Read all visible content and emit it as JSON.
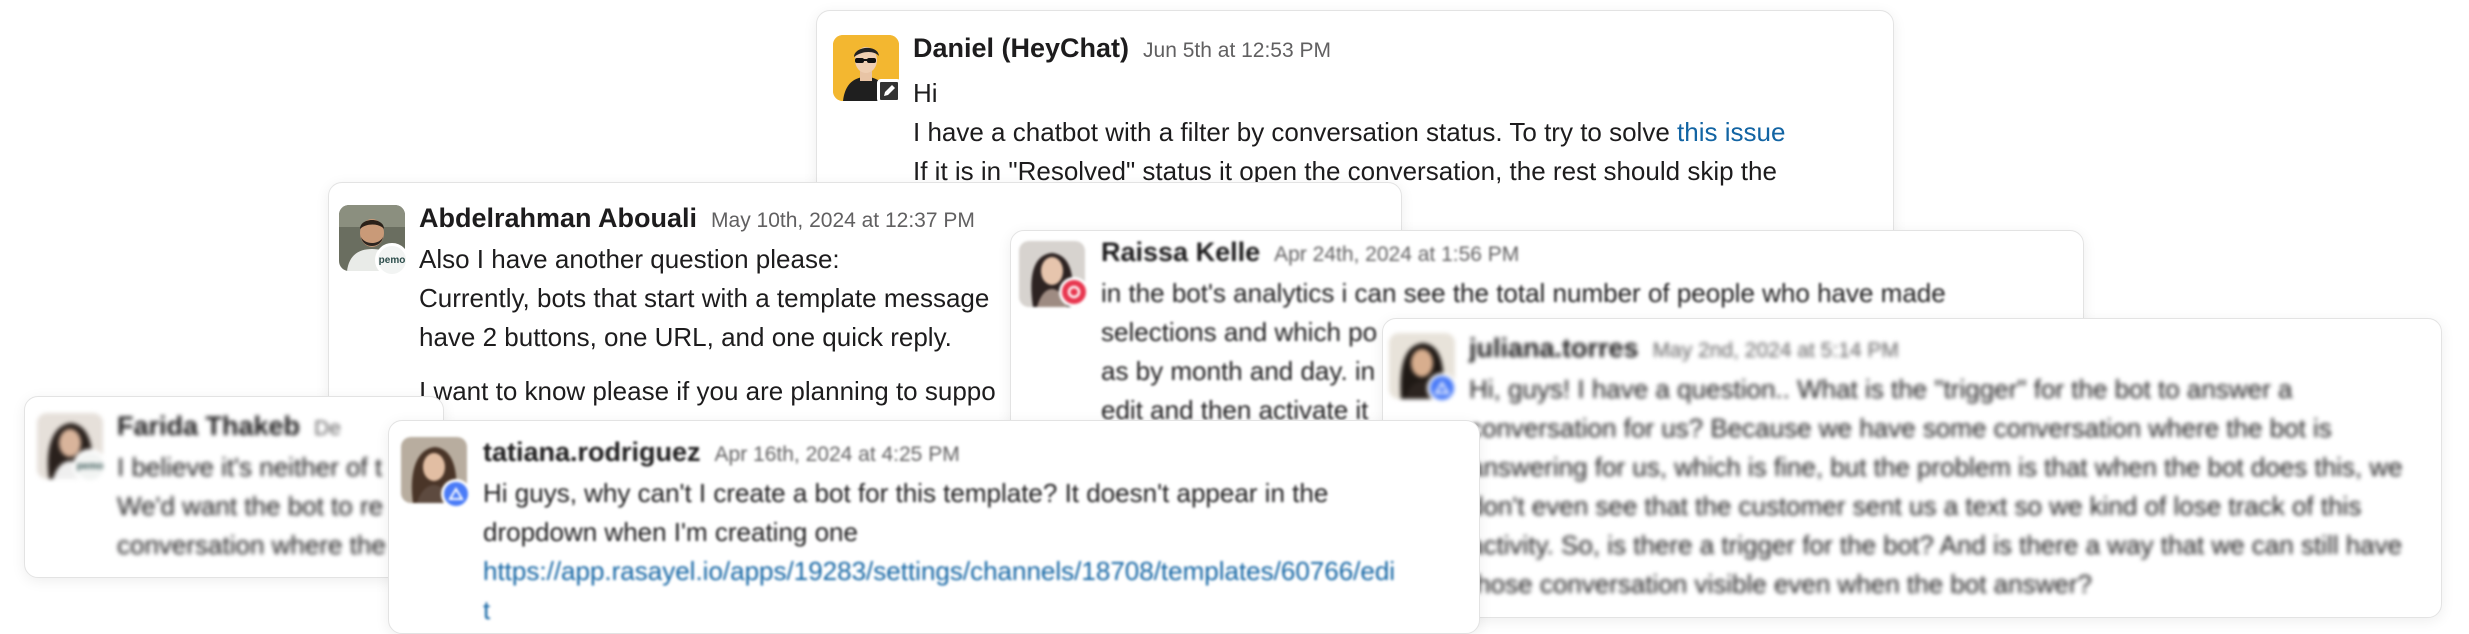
{
  "messages": [
    {
      "id": "daniel",
      "author": "Daniel (HeyChat)",
      "timestamp": "Jun 5th at 12:53 PM",
      "lines": [
        {
          "text": "Hi"
        },
        {
          "text": "I have a chatbot with a filter by conversation status. To try to solve ",
          "link": "this issue"
        },
        {
          "text": "If it is in \"Resolved\" status it open the conversation, the rest should skip the"
        }
      ]
    },
    {
      "id": "abdelrahman",
      "author": "Abdelrahman Abouali",
      "timestamp": "May 10th, 2024 at 12:37 PM",
      "badge_text": "pemo",
      "lines": [
        {
          "text": "Also I have another question please:"
        },
        {
          "text": "Currently, bots that start with a template message"
        },
        {
          "text": "have 2 buttons, one URL, and one quick reply."
        },
        {
          "text": "I want to know please if you are planning to suppo"
        }
      ]
    },
    {
      "id": "raissa",
      "author": "Raissa Kelle",
      "timestamp": "Apr 24th, 2024 at 1:56 PM",
      "lines": [
        {
          "text": "in the bot's analytics i can see the total number of people who have made"
        },
        {
          "text": "selections and which po"
        },
        {
          "text": "as by month and day. in"
        },
        {
          "text": "edit and then activate it"
        }
      ]
    },
    {
      "id": "juliana",
      "author": "juliana.torres",
      "timestamp": "May 2nd, 2024 at 5:14 PM",
      "lines": [
        {
          "text": "Hi, guys! I have a question.. What is the \"trigger\" for the bot to answer a"
        },
        {
          "text": "conversation for us? Because we have some conversation where the bot is"
        },
        {
          "text": "answering for us, which is fine, but the problem is that when the bot does this, we"
        },
        {
          "text": "don't even see that the customer sent us a text so we kind of lose track of this"
        },
        {
          "text": "activity. So, is there a trigger for the bot? And is there a way that we can still have"
        },
        {
          "text": "those conversation visible even when the bot answer?"
        }
      ]
    },
    {
      "id": "farida",
      "author": "Farida Thakeb",
      "timestamp": "De",
      "badge_text": "pemo",
      "lines": [
        {
          "text": "I believe it's neither of t"
        },
        {
          "text": "We'd want the bot to re"
        },
        {
          "text": "conversation where the"
        }
      ]
    },
    {
      "id": "tatiana",
      "author": "tatiana.rodriguez",
      "timestamp": "Apr 16th, 2024 at 4:25 PM",
      "lines": [
        {
          "text": "Hi guys, why can't I create a bot for this template? It doesn't appear in the"
        },
        {
          "text": "dropdown when I'm creating one"
        },
        {
          "link": "https://app.rasayel.io/apps/19283/settings/channels/18708/templates/60766/edi"
        },
        {
          "link": "t"
        }
      ]
    }
  ],
  "colors": {
    "link": "#1264a3",
    "text": "#1d1c1d",
    "muted": "#616061",
    "raissa_badge": "#e8364f",
    "slack_badge": "#4a7bf7",
    "pemo_badge": "#f2f4f3"
  },
  "icons": {
    "daniel_badge": "pencil-icon",
    "raissa_badge": "ring-icon",
    "juliana_badge": "triangle-icon",
    "tatiana_badge": "triangle-icon"
  }
}
